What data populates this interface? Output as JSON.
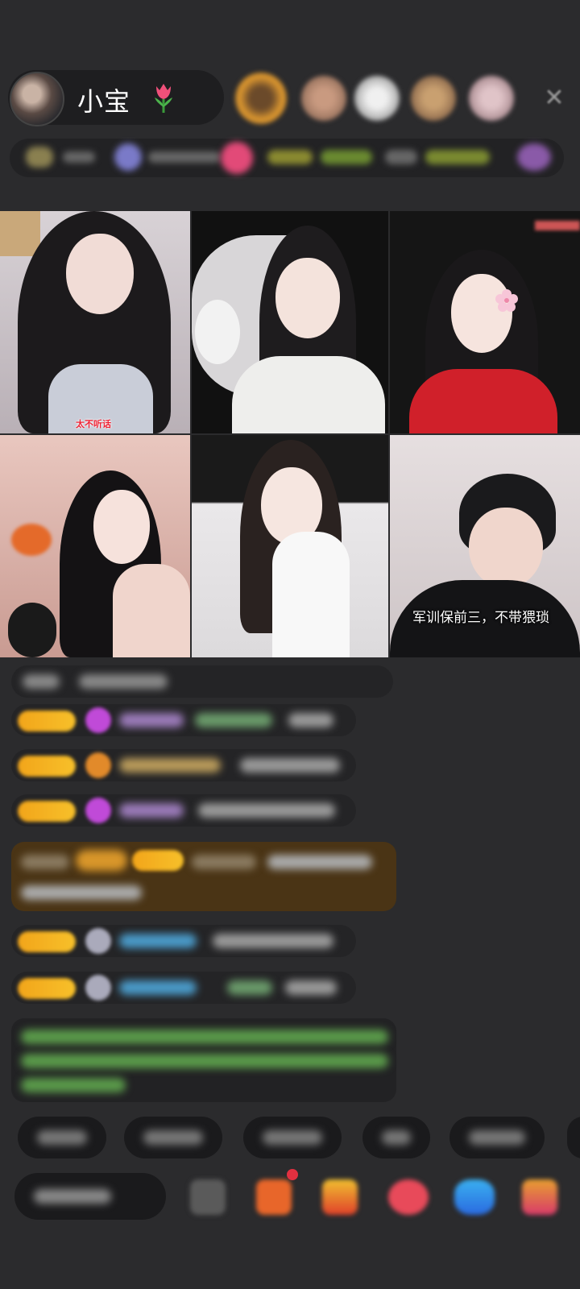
{
  "host": {
    "name": "小宝",
    "name_emoji": "tulip-icon"
  },
  "viewers": [
    {
      "avatar": "viewer-avatar-1",
      "color": "#d08a2a"
    },
    {
      "avatar": "viewer-avatar-2",
      "color": "#b07a60"
    },
    {
      "avatar": "viewer-avatar-3",
      "color": "#cfcfcf"
    },
    {
      "avatar": "viewer-avatar-4",
      "color": "#a47a55"
    },
    {
      "avatar": "viewer-avatar-5",
      "color": "#b89aa0"
    }
  ],
  "close_icon": "close-icon",
  "grid": {
    "tiles": [
      {
        "caption": "太不听话"
      },
      {
        "caption": ""
      },
      {
        "caption": ""
      },
      {
        "caption": ""
      },
      {
        "caption": ""
      },
      {
        "caption": "",
        "subtitle": "军训保前三，不带猥琐"
      }
    ]
  },
  "colors": {
    "badge": "#f2a51a",
    "gift_banner": "#4a3415",
    "accent_red": "#e23040"
  }
}
